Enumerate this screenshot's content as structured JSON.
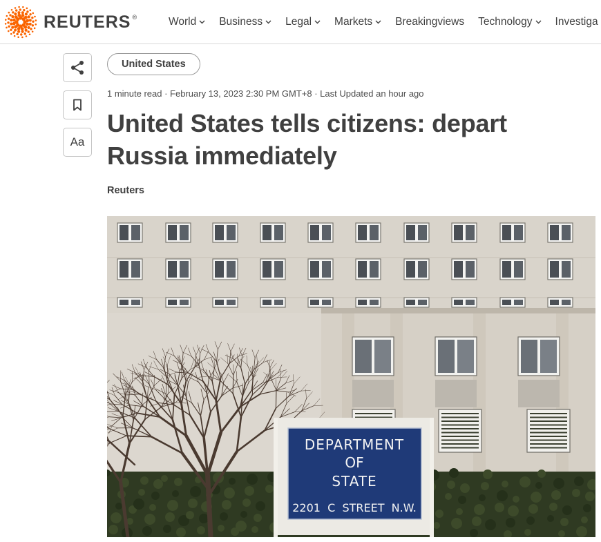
{
  "brand": {
    "name": "REUTERS",
    "mark": "®"
  },
  "nav": {
    "items": [
      {
        "label": "World",
        "has_dropdown": true
      },
      {
        "label": "Business",
        "has_dropdown": true
      },
      {
        "label": "Legal",
        "has_dropdown": true
      },
      {
        "label": "Markets",
        "has_dropdown": true
      },
      {
        "label": "Breakingviews",
        "has_dropdown": false
      },
      {
        "label": "Technology",
        "has_dropdown": true
      },
      {
        "label": "Investiga",
        "has_dropdown": false
      }
    ]
  },
  "actions": {
    "share_icon": "share-icon",
    "bookmark_icon": "bookmark-icon",
    "text_size_label": "Aa"
  },
  "article": {
    "topic": "United States",
    "meta": "1 minute read · February 13, 2023 2:30 PM GMT+8 · Last Updated an hour ago",
    "headline": "United States tells citizens: depart Russia immediately",
    "byline": "Reuters"
  },
  "photo": {
    "sign_lines": [
      "DEPARTMENT",
      "OF",
      "STATE",
      "2201  C  STREET  N.W."
    ]
  },
  "colors": {
    "brand_orange": "#fa6400",
    "text": "#404040",
    "sign_blue": "#1f3a78"
  }
}
